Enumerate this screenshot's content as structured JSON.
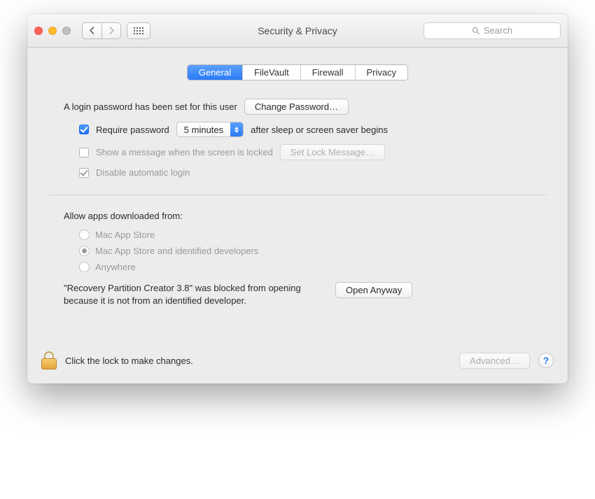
{
  "window": {
    "title": "Security & Privacy",
    "search_placeholder": "Search"
  },
  "tabs": {
    "general": "General",
    "filevault": "FileVault",
    "firewall": "Firewall",
    "privacy": "Privacy",
    "active": "general"
  },
  "login": {
    "password_set_text": "A login password has been set for this user",
    "change_password_btn": "Change Password…",
    "require_password_label": "Require password",
    "require_password_delay": "5 minutes",
    "require_password_suffix": "after sleep or screen saver begins",
    "require_password_checked": true,
    "show_message_label": "Show a message when the screen is locked",
    "show_message_checked": false,
    "set_lock_message_btn": "Set Lock Message…",
    "disable_auto_login_label": "Disable automatic login",
    "disable_auto_login_checked": true
  },
  "gatekeeper": {
    "section_title": "Allow apps downloaded from:",
    "options": {
      "app_store": "Mac App Store",
      "identified": "Mac App Store and identified developers",
      "anywhere": "Anywhere"
    },
    "selected": "identified",
    "blocked_message": "\"Recovery Partition Creator 3.8\" was blocked from opening because it is not from an identified developer.",
    "open_anyway_btn": "Open Anyway"
  },
  "footer": {
    "lock_text": "Click the lock to make changes.",
    "advanced_btn": "Advanced…",
    "help_label": "?"
  }
}
